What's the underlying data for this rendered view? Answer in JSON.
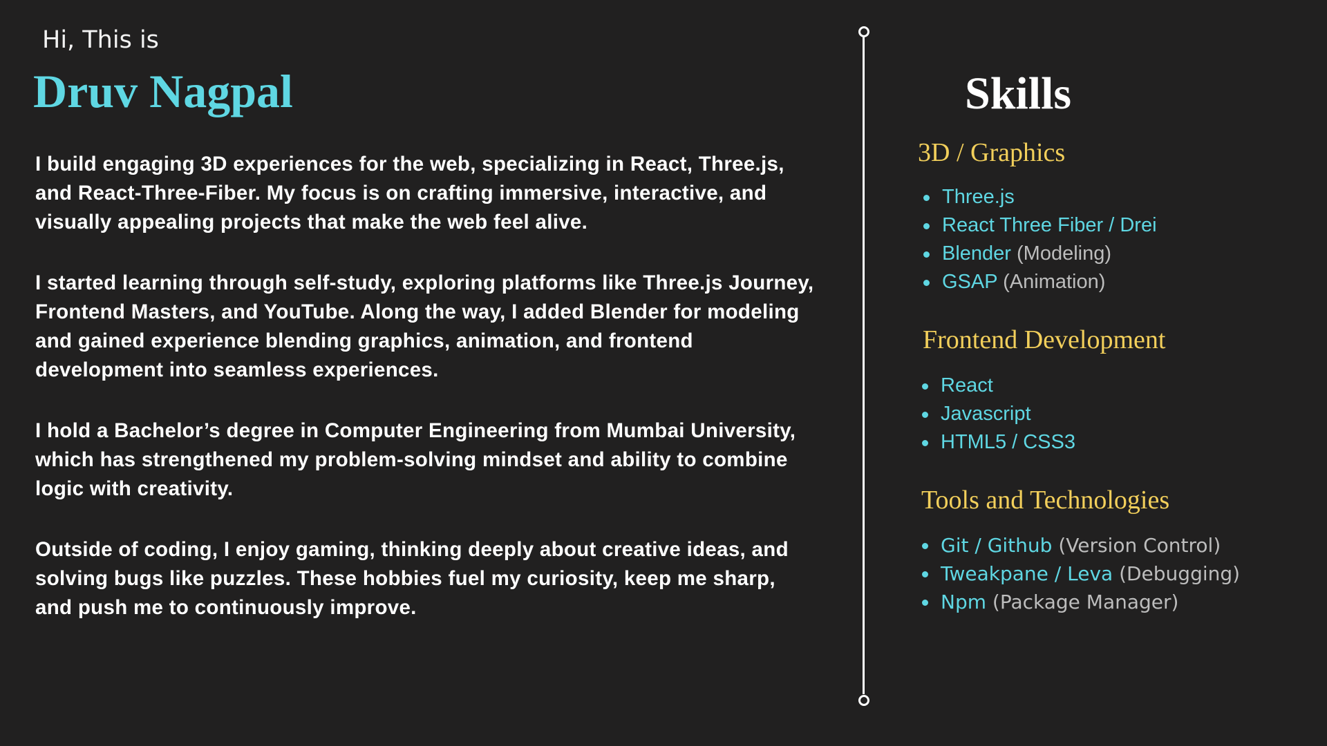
{
  "intro": {
    "greeting": "Hi, This is",
    "name": "Druv Nagpal",
    "paragraphs": [
      "I build engaging 3D experiences for the web, specializing in React, Three.js, and React-Three-Fiber. My focus is on crafting immersive, interactive, and visually appealing projects that make the web feel alive.",
      "I started learning through self-study, exploring platforms like Three.js Journey, Frontend Masters, and YouTube. Along the way, I added Blender for modeling and gained experience blending graphics, animation, and frontend development into seamless experiences.",
      "I hold a Bachelor’s degree in Computer Engineering from Mumbai University, which has strengthened my problem-solving mindset and ability to combine logic with creativity.",
      "Outside of coding, I enjoy gaming, thinking deeply about creative ideas, and solving bugs like puzzles. These hobbies fuel my curiosity, keep me sharp, and push me to continuously improve."
    ]
  },
  "skills": {
    "title": "Skills",
    "categories": [
      {
        "title": "3D / Graphics",
        "items": [
          {
            "name": "Three.js",
            "note": ""
          },
          {
            "name": "React Three Fiber / Drei",
            "note": ""
          },
          {
            "name": "Blender",
            "note": " (Modeling)"
          },
          {
            "name": "GSAP",
            "note": " (Animation)"
          }
        ]
      },
      {
        "title": "Frontend Development",
        "items": [
          {
            "name": "React",
            "note": ""
          },
          {
            "name": "Javascript",
            "note": ""
          },
          {
            "name": "HTML5 / CSS3",
            "note": ""
          }
        ]
      },
      {
        "title": "Tools and Technologies",
        "items": [
          {
            "name": "Git / Github",
            "note": " (Version Control)"
          },
          {
            "name": "Tweakpane / Leva",
            "note": " (Debugging)"
          },
          {
            "name": "Npm",
            "note": " (Package Manager)"
          }
        ]
      }
    ]
  },
  "colors": {
    "background": "#212020",
    "accent_cyan": "#5fd7e3",
    "accent_gold": "#f2cf5b",
    "muted": "#bdbdbd",
    "text": "#ffffff"
  }
}
